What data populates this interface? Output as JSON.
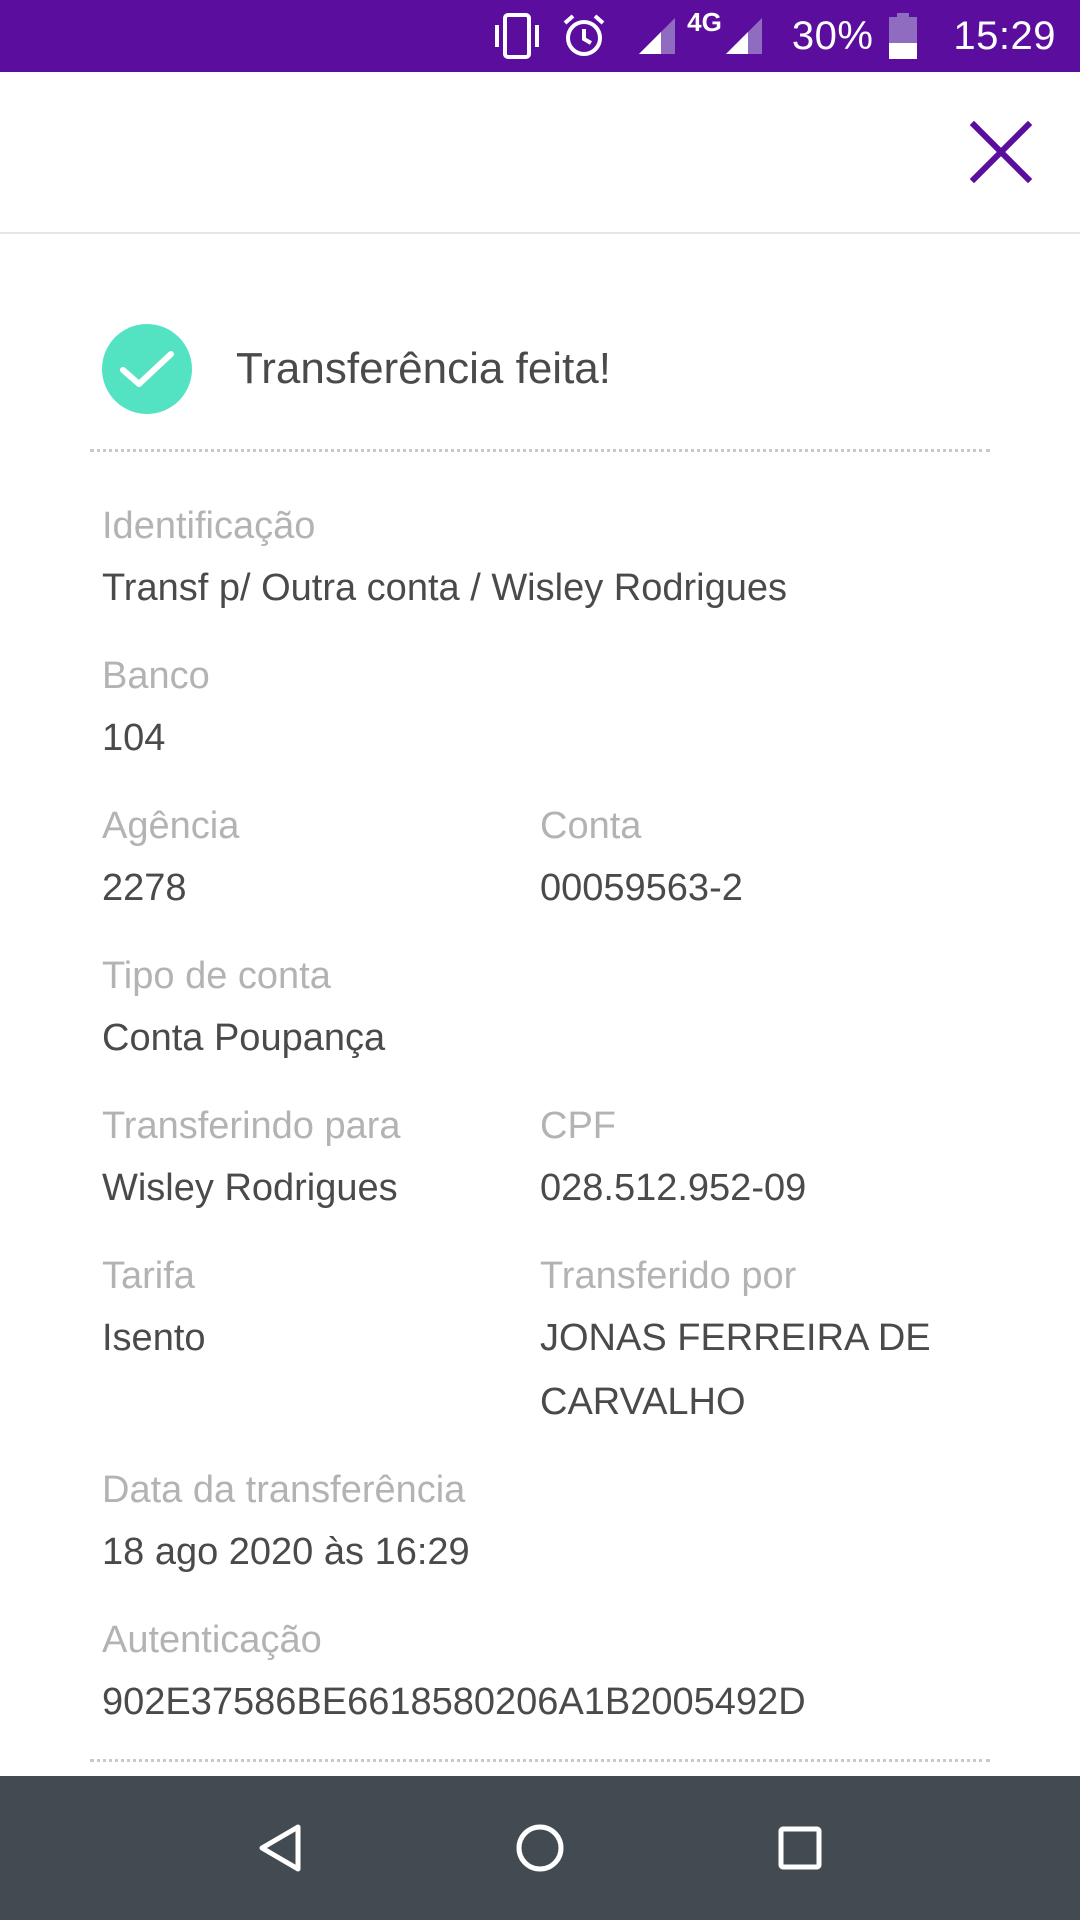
{
  "status_bar": {
    "network_label": "4G",
    "battery": "30%",
    "time": "15:29",
    "icons": [
      "vibrate-icon",
      "alarm-icon",
      "signal-icon",
      "signal-icon",
      "battery-icon"
    ]
  },
  "colors": {
    "accent": "#5b0e9e",
    "success": "#53e3c3",
    "label": "#b3b3b3",
    "value": "#4a4a4a",
    "nav_bar": "#434b52"
  },
  "header": {
    "close_icon": "close-icon"
  },
  "receipt": {
    "title": "Transferência feita!",
    "fields": {
      "identificacao": {
        "label": "Identificação",
        "value": "Transf p/ Outra conta / Wisley Rodrigues"
      },
      "banco": {
        "label": "Banco",
        "value": "104"
      },
      "agencia": {
        "label": "Agência",
        "value": "2278"
      },
      "conta": {
        "label": "Conta",
        "value": "00059563-2"
      },
      "tipo_conta": {
        "label": "Tipo de conta",
        "value": "Conta Poupança"
      },
      "transferindo_para": {
        "label": "Transferindo para",
        "value": "Wisley Rodrigues"
      },
      "cpf": {
        "label": "CPF",
        "value": "028.512.952-09"
      },
      "tarifa": {
        "label": "Tarifa",
        "value": "Isento"
      },
      "transferido_por": {
        "label": "Transferido por",
        "value_line1": "JONAS FERREIRA DE",
        "value_line2": "CARVALHO"
      },
      "data": {
        "label": "Data da transferência",
        "value": "18 ago 2020 às 16:29"
      },
      "autenticacao": {
        "label": "Autenticação",
        "value": "902E37586BE6618580206A1B2005492D"
      }
    }
  },
  "nav_bar": {
    "buttons": [
      "back-icon",
      "home-icon",
      "recents-icon"
    ]
  }
}
